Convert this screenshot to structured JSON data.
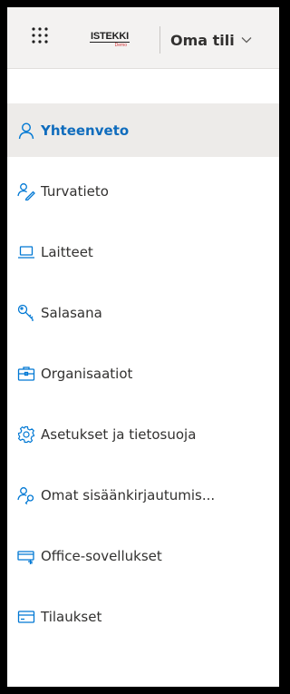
{
  "colors": {
    "accent": "#0f6cbd",
    "icon": "#0078d4",
    "text": "#323130",
    "active_bg": "#edebe9",
    "header_bg": "#f3f2f1",
    "logo_red": "#d13438"
  },
  "header": {
    "app_launcher_icon": "waffle-icon",
    "logo": {
      "name": "ISTEKKI",
      "tag": "Demo"
    },
    "account_label": "Oma tili",
    "account_chevron_icon": "chevron-down-icon"
  },
  "nav": {
    "items": [
      {
        "label": "Yhteenveto",
        "icon": "person-icon",
        "active": true
      },
      {
        "label": "Turvatieto",
        "icon": "person-pen-icon",
        "active": false
      },
      {
        "label": "Laitteet",
        "icon": "laptop-icon",
        "active": false
      },
      {
        "label": "Salasana",
        "icon": "key-icon",
        "active": false
      },
      {
        "label": "Organisaatiot",
        "icon": "briefcase-icon",
        "active": false
      },
      {
        "label": "Asetukset ja tietosuoja",
        "icon": "gear-icon",
        "active": false
      },
      {
        "label": "Omat sisäänkirjautumis...",
        "icon": "person-key-icon",
        "active": false
      },
      {
        "label": "Office-sovellukset",
        "icon": "apps-device-icon",
        "active": false
      },
      {
        "label": "Tilaukset",
        "icon": "card-icon",
        "active": false
      }
    ]
  }
}
